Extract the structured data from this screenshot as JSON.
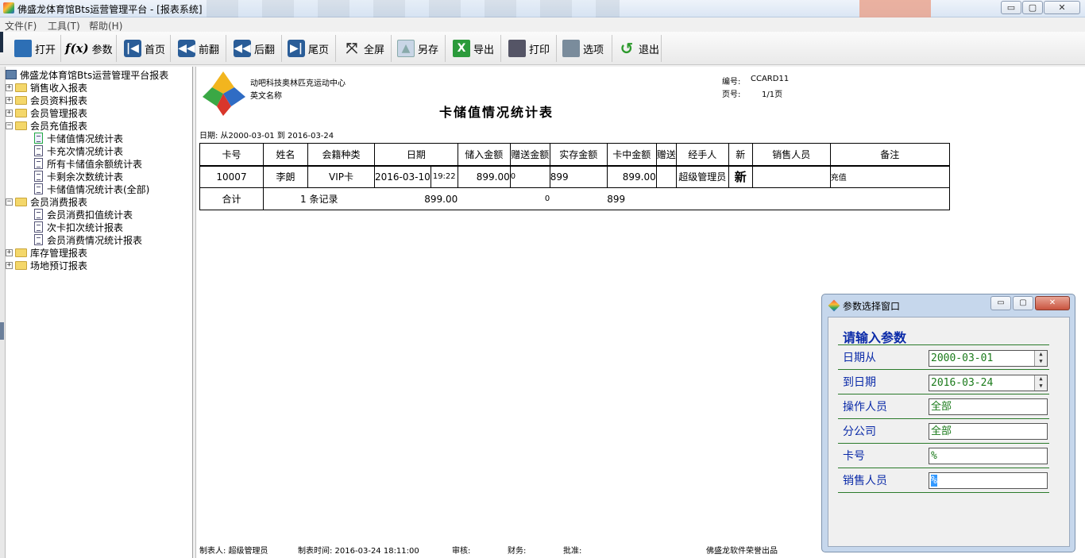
{
  "window": {
    "title": "佛盛龙体育馆Bts运营管理平台 - [报表系统]",
    "min": "▭",
    "max": "▢",
    "close": "✕"
  },
  "menu": [
    "文件(F)",
    "工具(T)",
    "帮助(H)"
  ],
  "toolbar": [
    {
      "label": "打开",
      "icon": "open-icon"
    },
    {
      "label": "参数",
      "icon": "fx-icon",
      "glyph": "f(x)"
    },
    {
      "label": "首页",
      "icon": "first-page-icon",
      "glyph": "|◀"
    },
    {
      "label": "前翻",
      "icon": "prev-page-icon",
      "glyph": "◀◀"
    },
    {
      "label": "后翻",
      "icon": "next-page-icon",
      "glyph": "◀◀"
    },
    {
      "label": "尾页",
      "icon": "last-page-icon",
      "glyph": "▶|"
    },
    {
      "label": "全屏",
      "icon": "fullscreen-icon",
      "glyph": "⤧"
    },
    {
      "label": "另存",
      "icon": "save-as-icon",
      "glyph": "▲"
    },
    {
      "label": "导出",
      "icon": "export-excel-icon",
      "glyph": "X"
    },
    {
      "label": "打印",
      "icon": "print-icon",
      "glyph": ""
    },
    {
      "label": "选项",
      "icon": "options-icon",
      "glyph": ""
    },
    {
      "label": "退出",
      "icon": "exit-icon",
      "glyph": "↺"
    }
  ],
  "tree": {
    "root": "佛盛龙体育馆Bts运营管理平台报表",
    "folders": [
      {
        "label": "销售收入报表",
        "expanded": false,
        "items": []
      },
      {
        "label": "会员资料报表",
        "expanded": false,
        "items": []
      },
      {
        "label": "会员管理报表",
        "expanded": false,
        "items": []
      },
      {
        "label": "会员充值报表",
        "expanded": true,
        "items": [
          "卡储值情况统计表",
          "卡充次情况统计表",
          "所有卡储值余额统计表",
          "卡剩余次数统计表",
          "卡储值情况统计表(全部)"
        ]
      },
      {
        "label": "会员消费报表",
        "expanded": true,
        "items": [
          "会员消费扣值统计表",
          "次卡扣次统计报表",
          "会员消费情况统计报表"
        ]
      },
      {
        "label": "库存管理报表",
        "expanded": false,
        "items": []
      },
      {
        "label": "场地预订报表",
        "expanded": false,
        "items": []
      }
    ]
  },
  "report": {
    "company": "动吧科技奥林匹克运动中心",
    "english_name": "英文名称",
    "code_label": "编号:",
    "code_value": "CCARD11",
    "page_label": "页号:",
    "page_value": "1/1页",
    "title": "卡储值情况统计表",
    "date_range": "日期: 从2000-03-01  到  2016-03-24",
    "columns": [
      "卡号",
      "姓名",
      "会籍种类",
      "日期",
      "储入金额",
      "赠送金额",
      "实存金额",
      "卡中金额",
      "赠送",
      "经手人",
      "新",
      "销售人员",
      "备注"
    ],
    "row": {
      "card_no": "10007",
      "name": "李朗",
      "type": "VIP卡",
      "date": "2016-03-10",
      "time": "19:22",
      "deposit": "899.00",
      "bonus": "0",
      "actual": "899",
      "balance": "899.00",
      "gift": "",
      "handler": "超级管理员",
      "new_flag": "新",
      "sales": "",
      "remark": "充值"
    },
    "summary": {
      "label": "合计",
      "records": "1 条记录",
      "deposit": "899.00",
      "bonus": "0",
      "actual": "899"
    },
    "footer": {
      "maker": "制表人: 超级管理员",
      "made_time": "制表时间: 2016-03-24 18:11:00",
      "audit": "审核:",
      "finance": "财务:",
      "approve": "批准:",
      "producer": "佛盛龙软件荣誉出品"
    }
  },
  "dialog": {
    "title": "参数选择窗口",
    "heading": "请输入参数",
    "fields": [
      {
        "label": "日期从",
        "value": "2000-03-01",
        "spinner": true
      },
      {
        "label": "到日期",
        "value": "2016-03-24",
        "spinner": true
      },
      {
        "label": "操作人员",
        "value": "全部",
        "spinner": false
      },
      {
        "label": "分公司",
        "value": "全部",
        "spinner": false
      },
      {
        "label": "卡号",
        "value": "%",
        "spinner": false
      },
      {
        "label": "销售人员",
        "value": "%",
        "spinner": false,
        "selected": true
      }
    ]
  }
}
